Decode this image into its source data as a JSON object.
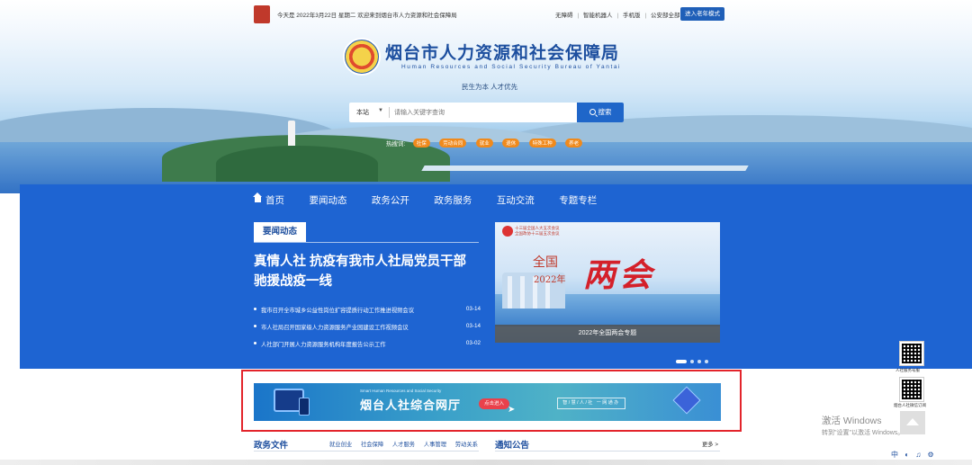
{
  "topbar": {
    "date_text": "今天是 2022年3月22日 星期二 欢迎来到烟台市人力资源和社会保障局",
    "links": [
      "无障碍",
      "智能机器人",
      "手机版",
      "公安部全部网"
    ],
    "elder_mode": "进入老年模式"
  },
  "brand": {
    "title": "烟台市人力资源和社会保障局",
    "subtitle": "Human Resources and Social Security Bureau of Yantai",
    "slogan": "民生为本 人才优先"
  },
  "search": {
    "scope": "本站",
    "placeholder": "请输入关键字查询",
    "button": "搜索"
  },
  "hot": {
    "label": "热搜词:",
    "tags": [
      "社保",
      "劳动合同",
      "就业",
      "退休",
      "特殊工种",
      "养老"
    ]
  },
  "nav": {
    "items": [
      "首页",
      "要闻动态",
      "政务公开",
      "政务服务",
      "互动交流",
      "专题专栏"
    ]
  },
  "news": {
    "tab": "要闻动态",
    "headline": "真情人社 抗疫有我市人社局党员干部驰援战疫一线",
    "items": [
      {
        "title": "我市召开全市城乡公益性岗位扩容提质行动工作推进视频会议",
        "date": "03-14"
      },
      {
        "title": "市人社局召开国家级人力资源服务产业园建设工作视频会议",
        "date": "03-14"
      },
      {
        "title": "人社部门开展人力资源服务机构年度报告公示工作",
        "date": "03-02"
      }
    ]
  },
  "banner": {
    "meeting_line1": "十三届全国人大五次会议",
    "meeting_line2": "全国政协十三届五次会议",
    "national": "全国",
    "year": "2022年",
    "big_text": "两会",
    "caption": "2022年全国两会专题"
  },
  "promo": {
    "en": "Smart Human Resources and Social Security",
    "zh": "烟台人社综合网厅",
    "enter": "点击进入",
    "slogan": "智/慧/人/社 一网通办"
  },
  "sections": {
    "policy_title": "政务文件",
    "policy_tabs": [
      "就业创业",
      "社会保障",
      "人才服务",
      "人事管理",
      "劳动关系"
    ],
    "notice_title": "通知公告",
    "more": "更多 >"
  },
  "side": {
    "qr1_label": "人社服务号服",
    "qr2_label": "烟台人社微信订阅"
  },
  "windows": {
    "line1": "激活 Windows",
    "line2": "转到\"设置\"以激活 Windows。",
    "ime": [
      "中",
      "◐",
      "♫",
      "⚙"
    ]
  },
  "colors": {
    "brand_blue": "#1e64d2",
    "title_blue": "#1d4f9f",
    "hot_orange": "#f08a1c",
    "highlight_red": "#e3242b"
  }
}
